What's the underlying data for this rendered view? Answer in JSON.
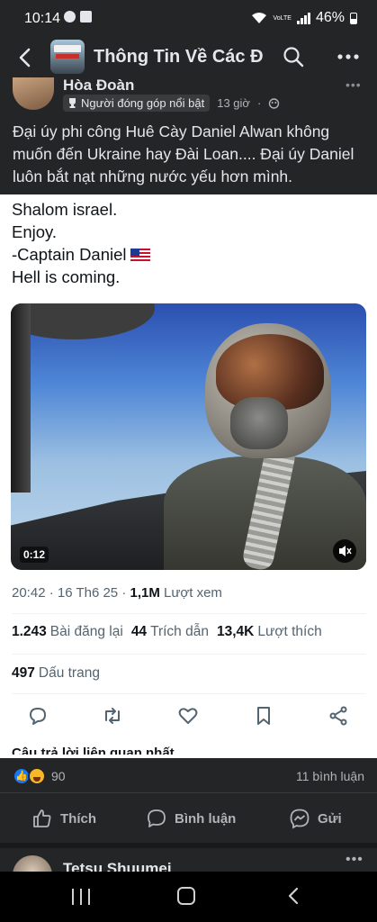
{
  "status_bar": {
    "time": "10:14",
    "network_label": "VoLTE",
    "battery": "46%"
  },
  "app_bar": {
    "title": "Thông Tin Về Các Đ...",
    "icons": [
      "back-arrow-icon",
      "search-icon",
      "more-icon"
    ]
  },
  "post": {
    "author": "Hòa Đoàn",
    "badge": "Người đóng góp nổi bật",
    "time": "13 giờ",
    "caption": "Đại úy phi công Huê Cày Daniel Alwan không muốn đến Ukraine hay Đài Loan.... Đại úy Daniel luôn bắt nạt những nước yếu hơn mình."
  },
  "tweet": {
    "lines": [
      "Shalom israel.",
      "Enjoy.",
      "-Captain Daniel",
      "Hell is coming."
    ],
    "video_duration": "0:12",
    "meta": {
      "datetime": "20:42 · 16 Th6 25 · ",
      "views_value": "1,1M",
      "views_label": "Lượt xem"
    },
    "stats": [
      {
        "value": "1.243",
        "label": "Bài đăng lại"
      },
      {
        "value": "44",
        "label": "Trích dẫn"
      },
      {
        "value": "13,4K",
        "label": "Lượt thích"
      }
    ],
    "bookmarks": {
      "value": "497",
      "label": "Dấu trang"
    },
    "cut_text": "Câu trả lời liên quan nhất"
  },
  "reactions": {
    "count": "90",
    "comments": "11 bình luận"
  },
  "action_bar": {
    "like": "Thích",
    "comment": "Bình luận",
    "share": "Gửi"
  },
  "next_post": {
    "author": "Tetsu Shuumei"
  }
}
